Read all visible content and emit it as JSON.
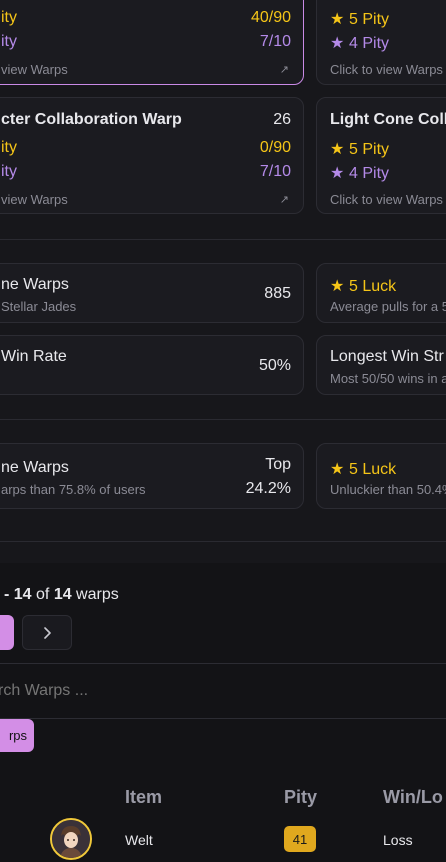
{
  "colors": {
    "accent": "#c98ae6",
    "gold": "#f5c518",
    "purple": "#b48ae8",
    "background": "#17171b"
  },
  "banner_cards": [
    {
      "five_pity_label": "ity",
      "five_pity_value": "40/90",
      "four_pity_label": "ity",
      "four_pity_value": "7/10",
      "link_text": "view Warps",
      "link_icon": "external-link-icon"
    },
    {
      "title": "cter Collaboration Warp",
      "count": "26",
      "five_pity_label": "ity",
      "five_pity_value": "0/90",
      "four_pity_label": "ity",
      "four_pity_value": "7/10",
      "link_text": "view Warps",
      "link_icon": "external-link-icon"
    }
  ],
  "side_cards": [
    {
      "five_pity": "5 Pity",
      "four_pity": "4 Pity",
      "link_text": "Click to view Warps"
    },
    {
      "title": "Light Cone Coll",
      "five_pity": "5 Pity",
      "four_pity": "4 Pity",
      "link_text": "Click to view Warps"
    }
  ],
  "stats": {
    "total_warps": {
      "title": "ne Warps",
      "subtitle": "Stellar Jades",
      "value": "885"
    },
    "luck_avg": {
      "title": "5 Luck",
      "subtitle": "Average pulls for a 5"
    },
    "win_rate": {
      "title": "Win Rate",
      "value": "50%"
    },
    "longest_streak": {
      "title": "Longest Win Str",
      "subtitle": "Most 50/50 wins in a"
    }
  },
  "rank": {
    "warps": {
      "title": "ne Warps",
      "subtitle": "arps than 75.8% of users",
      "top_label": "Top",
      "top_value": "24.2%"
    },
    "luck": {
      "title": "5 Luck",
      "subtitle": "Unluckier than 50.4%"
    }
  },
  "pagination": {
    "dash": "- ",
    "start": "14",
    "of": " of ",
    "total": "14",
    "suffix": " warps"
  },
  "search": {
    "placeholder": "rch Warps ..."
  },
  "filter": {
    "label": "rps"
  },
  "table": {
    "headers": {
      "item": "Item",
      "pity": "Pity",
      "win": "Win/Lo"
    },
    "rows": [
      {
        "item": "Welt",
        "pity": "41",
        "result": "Loss",
        "pity_color": "#e0a81e"
      }
    ]
  }
}
